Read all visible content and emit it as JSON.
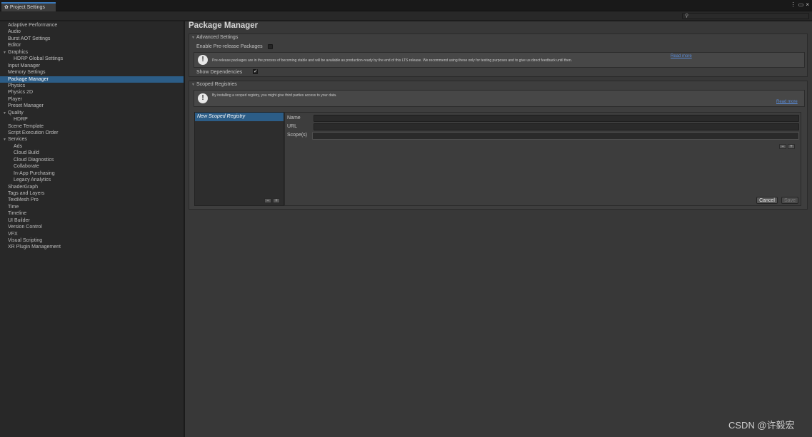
{
  "window": {
    "tab_title": "Project Settings",
    "controls": [
      "⋮",
      "▭",
      "×"
    ]
  },
  "search": {
    "placeholder": ""
  },
  "sidebar": {
    "items": [
      {
        "label": "Adaptive Performance",
        "indent": 0
      },
      {
        "label": "Audio",
        "indent": 0
      },
      {
        "label": "Burst AOT Settings",
        "indent": 0
      },
      {
        "label": "Editor",
        "indent": 0
      },
      {
        "label": "Graphics",
        "indent": 0,
        "expanded": true
      },
      {
        "label": "HDRP Global Settings",
        "indent": 1
      },
      {
        "label": "Input Manager",
        "indent": 0
      },
      {
        "label": "Memory Settings",
        "indent": 0
      },
      {
        "label": "Package Manager",
        "indent": 0,
        "selected": true
      },
      {
        "label": "Physics",
        "indent": 0
      },
      {
        "label": "Physics 2D",
        "indent": 0
      },
      {
        "label": "Player",
        "indent": 0
      },
      {
        "label": "Preset Manager",
        "indent": 0
      },
      {
        "label": "Quality",
        "indent": 0,
        "expanded": true
      },
      {
        "label": "HDRP",
        "indent": 1
      },
      {
        "label": "Scene Template",
        "indent": 0
      },
      {
        "label": "Script Execution Order",
        "indent": 0
      },
      {
        "label": "Services",
        "indent": 0,
        "expanded": true
      },
      {
        "label": "Ads",
        "indent": 1
      },
      {
        "label": "Cloud Build",
        "indent": 1
      },
      {
        "label": "Cloud Diagnostics",
        "indent": 1
      },
      {
        "label": "Collaborate",
        "indent": 1
      },
      {
        "label": "In-App Purchasing",
        "indent": 1
      },
      {
        "label": "Legacy Analytics",
        "indent": 1
      },
      {
        "label": "ShaderGraph",
        "indent": 0
      },
      {
        "label": "Tags and Layers",
        "indent": 0
      },
      {
        "label": "TextMesh Pro",
        "indent": 0
      },
      {
        "label": "Time",
        "indent": 0
      },
      {
        "label": "Timeline",
        "indent": 0
      },
      {
        "label": "UI Builder",
        "indent": 0
      },
      {
        "label": "Version Control",
        "indent": 0
      },
      {
        "label": "VFX",
        "indent": 0
      },
      {
        "label": "Visual Scripting",
        "indent": 0
      },
      {
        "label": "XR Plugin Management",
        "indent": 0
      }
    ]
  },
  "main": {
    "title": "Package Manager",
    "advanced": {
      "header": "Advanced Settings",
      "prerelease_label": "Enable Pre-release Packages",
      "prerelease_checked": false,
      "help_text": "Pre-release packages are in the process of becoming stable and will be available as production-ready by the end of this LTS release. We recommend using these only for testing purposes and to give us direct feedback until then.",
      "read_more": "Read more",
      "show_deps_label": "Show Dependencies",
      "show_deps_checked": true
    },
    "scoped": {
      "header": "Scoped Registries",
      "help_text": "By installing a scoped registry, you might give third parties access to your data.",
      "read_more": "Read more",
      "list_item": "New Scoped Registry",
      "list_remove": "−",
      "list_add": "+",
      "name_label": "Name",
      "url_label": "URL",
      "scopes_label": "Scope(s)",
      "scope_remove": "−",
      "scope_add": "+",
      "cancel_label": "Cancel",
      "save_label": "Save"
    }
  },
  "watermark": "CSDN @许毅宏",
  "colors": {
    "selection": "#2c5d87",
    "link": "#5a8bd8",
    "tab_accent": "#3a79bb"
  }
}
